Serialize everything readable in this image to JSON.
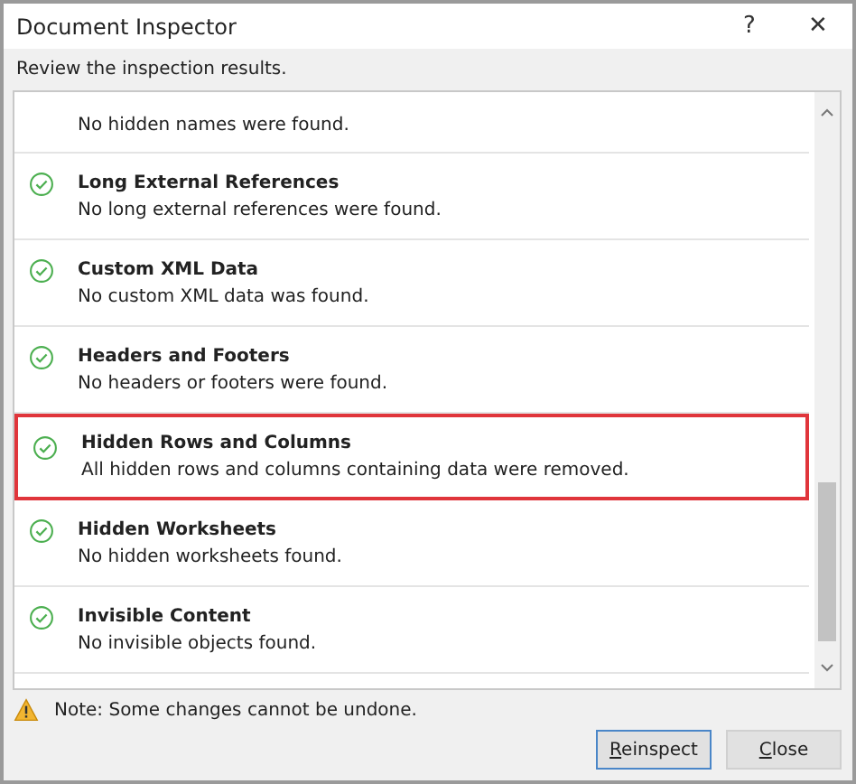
{
  "window": {
    "title": "Document Inspector",
    "help": "?",
    "close": "✕"
  },
  "instruction": "Review the inspection results.",
  "results": [
    {
      "description": "No hidden names were found.",
      "highlighted": false
    },
    {
      "title": "Long External References",
      "description": "No long external references were found.",
      "highlighted": false
    },
    {
      "title": "Custom XML Data",
      "description": "No custom XML data was found.",
      "highlighted": false
    },
    {
      "title": "Headers and Footers",
      "description": "No headers or footers were found.",
      "highlighted": false
    },
    {
      "title": "Hidden Rows and Columns",
      "description": "All hidden rows and columns containing data were removed.",
      "highlighted": true
    },
    {
      "title": "Hidden Worksheets",
      "description": "No hidden worksheets found.",
      "highlighted": false
    },
    {
      "title": "Invisible Content",
      "description": "No invisible objects found.",
      "highlighted": false
    }
  ],
  "note": "Note: Some changes cannot be undone.",
  "buttons": [
    {
      "label": "Reinspect",
      "default": true
    },
    {
      "label": "Close",
      "default": false
    }
  ]
}
